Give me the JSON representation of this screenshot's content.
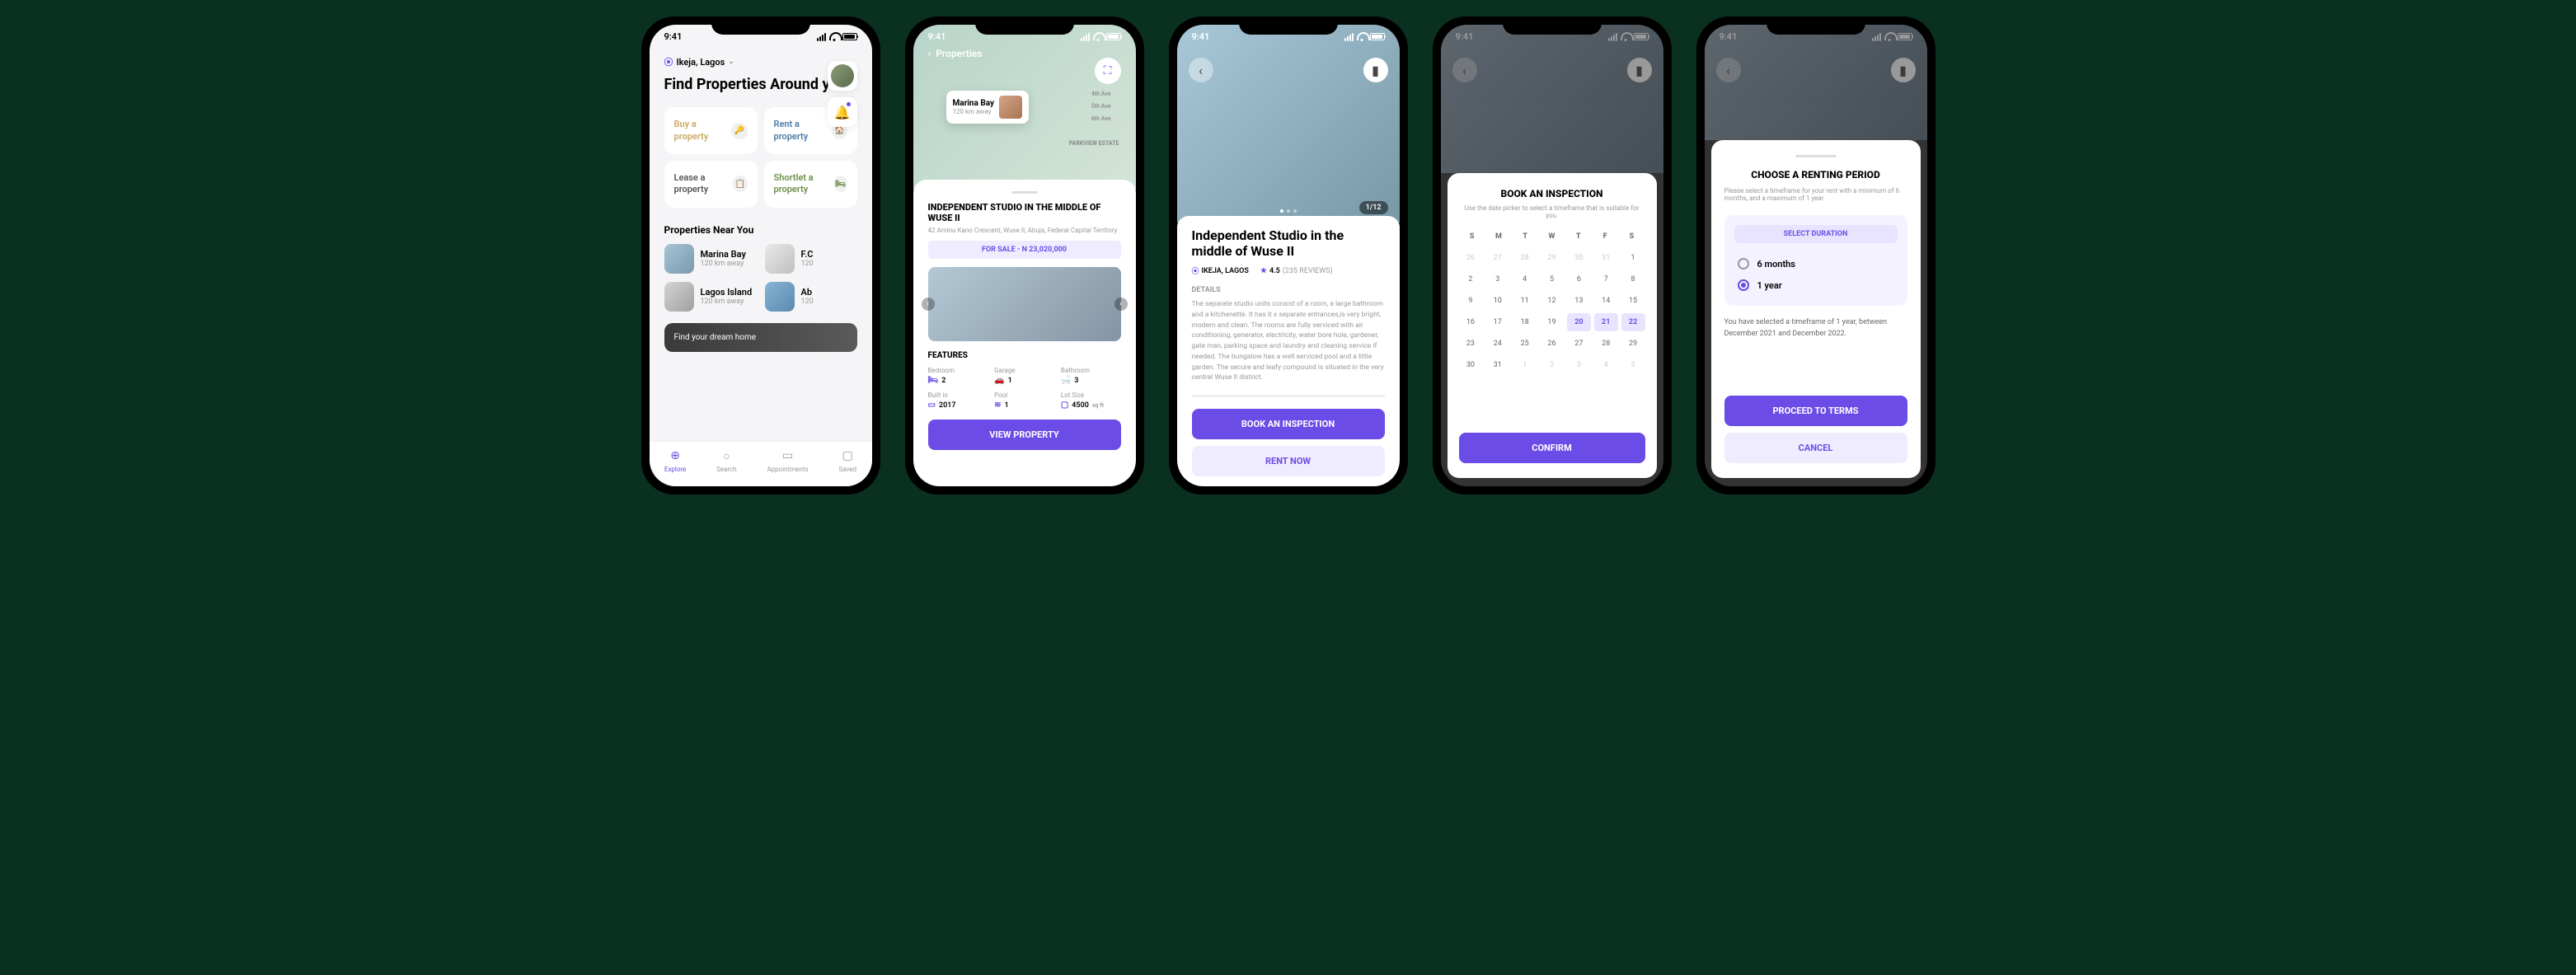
{
  "statusTime": "9:41",
  "screen1": {
    "location": "Ikeja, Lagos",
    "title": "Find Properties Around you",
    "categories": {
      "buy": "Buy a property",
      "rent": "Rent a property",
      "lease": "Lease a property",
      "shortlet": "Shortlet a property"
    },
    "nearTitle": "Properties Near You",
    "nearby": [
      {
        "name": "Marina Bay",
        "dist": "120 km away"
      },
      {
        "name": "F.C",
        "dist": "120"
      },
      {
        "name": "Lagos Island",
        "dist": "120 km away"
      },
      {
        "name": "Ab",
        "dist": "120"
      }
    ],
    "banner": "Find your dream home",
    "tabs": [
      "Explore",
      "Search",
      "Appointments",
      "Saved"
    ]
  },
  "screen2": {
    "headerLabel": "Properties",
    "mapPopup": {
      "name": "Marina Bay",
      "dist": "120 km away"
    },
    "mapLabels": [
      "4th Ave",
      "5th Ave",
      "6th Ave",
      "PARKVIEW ESTATE"
    ],
    "title": "INDEPENDENT STUDIO IN THE MIDDLE OF WUSE II",
    "address": "42 Aminu Kano Crescent, Wuse II, Abuja, Federal Capital Territory",
    "price": "FOR SALE - N 23,020,000",
    "featuresTitle": "FEATURES",
    "features": {
      "bedroomLabel": "Bedroom",
      "bedroom": "2",
      "garageLabel": "Garage",
      "garage": "1",
      "bathroomLabel": "Bathroom",
      "bathroom": "3",
      "builtLabel": "Built  in",
      "built": "2017",
      "poolLabel": "Pool",
      "pool": "1",
      "lotLabel": "Lot Size",
      "lot": "4500",
      "lotUnit": "sq ft"
    },
    "button": "VIEW PROPERTY"
  },
  "screen3": {
    "title": "Independent Studio in the middle of Wuse II",
    "location": "IKEJA, LAGOS",
    "rating": "4.5",
    "reviews": "(235 REVIEWS)",
    "counter": "1/12",
    "detailsLabel": "DETAILS",
    "description": "The separate studio units consist of a room, a large bathroom and a kitchenette. It has it s separate entrances,is very bright, modern and clean. The rooms are fully serviced with air conditioning, generator, electricity, water bore hole, gardener, gate man, parking space and laundry and cleaning service if needed. The bungalow has a well serviced pool and a little garden. The secure and leafy compound is situated in the very central Wuse II district.",
    "btnBook": "BOOK AN INSPECTION",
    "btnRent": "RENT NOW"
  },
  "screen4": {
    "title": "BOOK AN INSPECTION",
    "subtitle": "Use  the date picker to select a timeframe that is suitable for you.",
    "days": [
      "S",
      "M",
      "T",
      "W",
      "T",
      "F",
      "S"
    ],
    "weeks": [
      [
        {
          "d": "26",
          "m": true
        },
        {
          "d": "27",
          "m": true
        },
        {
          "d": "28",
          "m": true
        },
        {
          "d": "29",
          "m": true
        },
        {
          "d": "30",
          "m": true
        },
        {
          "d": "31",
          "m": true
        },
        {
          "d": "1"
        }
      ],
      [
        {
          "d": "2"
        },
        {
          "d": "3"
        },
        {
          "d": "4"
        },
        {
          "d": "5"
        },
        {
          "d": "6"
        },
        {
          "d": "7"
        },
        {
          "d": "8"
        }
      ],
      [
        {
          "d": "9"
        },
        {
          "d": "10"
        },
        {
          "d": "11"
        },
        {
          "d": "12"
        },
        {
          "d": "13"
        },
        {
          "d": "14"
        },
        {
          "d": "15"
        }
      ],
      [
        {
          "d": "16"
        },
        {
          "d": "17"
        },
        {
          "d": "18"
        },
        {
          "d": "19"
        },
        {
          "d": "20",
          "s": true
        },
        {
          "d": "21",
          "s": true
        },
        {
          "d": "22",
          "s": true
        }
      ],
      [
        {
          "d": "23"
        },
        {
          "d": "24"
        },
        {
          "d": "25"
        },
        {
          "d": "26"
        },
        {
          "d": "27"
        },
        {
          "d": "28"
        },
        {
          "d": "29"
        }
      ],
      [
        {
          "d": "30"
        },
        {
          "d": "31"
        },
        {
          "d": "1",
          "m": true
        },
        {
          "d": "2",
          "m": true
        },
        {
          "d": "3",
          "m": true
        },
        {
          "d": "4",
          "m": true
        },
        {
          "d": "5",
          "m": true
        }
      ]
    ],
    "button": "CONFIRM"
  },
  "screen5": {
    "title": "CHOOSE A RENTING PERIOD",
    "subtitle": "Please select a timeframe for your rent with a minimum of 6 months, and a maximum of 1 year",
    "selectLabel": "SELECT DURATION",
    "opt1": "6 months",
    "opt2": "1 year",
    "note": "You have selected a timeframe of 1 year, between December 2021 and December 2022.",
    "btnProceed": "PROCEED TO TERMS",
    "btnCancel": "CANCEL"
  }
}
